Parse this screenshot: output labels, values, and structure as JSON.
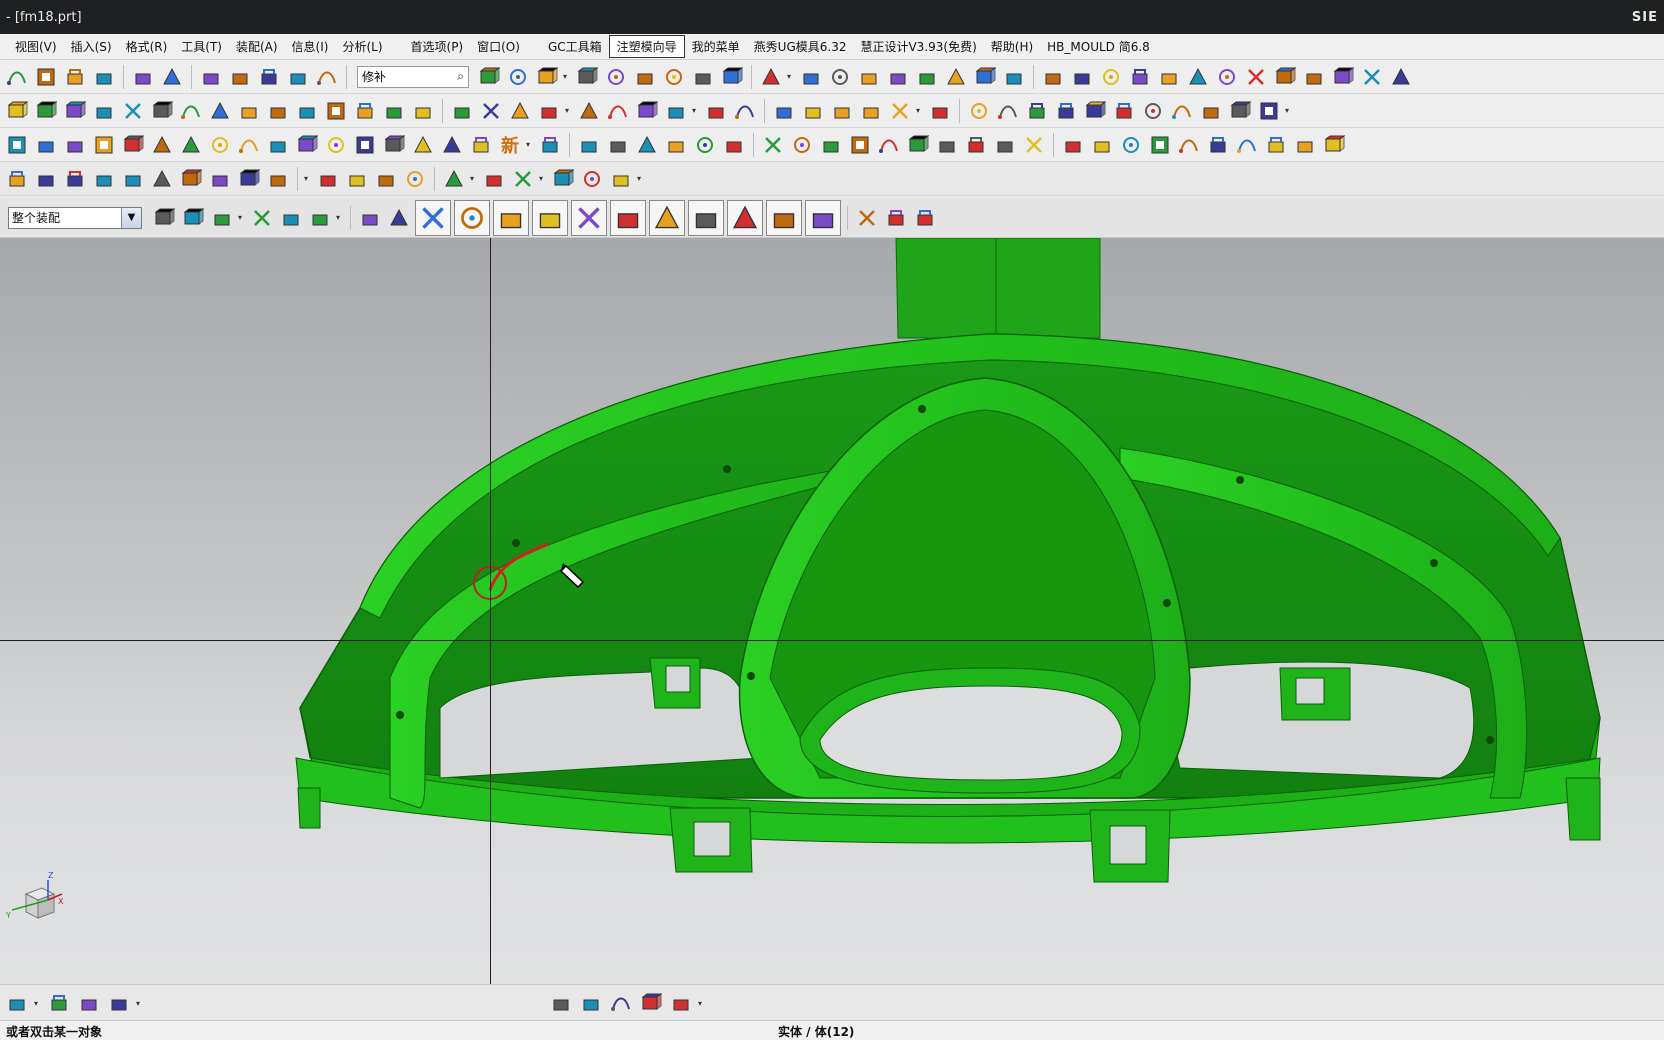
{
  "window": {
    "title": "- [fm18.prt]",
    "brand": "SIE"
  },
  "menu": {
    "items": [
      "视图(V)",
      "插入(S)",
      "格式(R)",
      "工具(T)",
      "装配(A)",
      "信息(I)",
      "分析(L)"
    ],
    "items2": [
      "首选项(P)",
      "窗口(O)"
    ],
    "items3": [
      "GC工具箱",
      "注塑模向导",
      "我的菜单",
      "燕秀UG模具6.32",
      "慧正设计V3.93(免费)",
      "帮助(H)",
      "HB_MOULD 简6.8"
    ]
  },
  "toolbar1": {
    "command_search_value": "修补"
  },
  "toolbar3": {
    "new_label": "新"
  },
  "selection": {
    "filter_value": "整个装配"
  },
  "status": {
    "prompt": "或者双击某一对象",
    "selection_info": "实体 / 体(12)"
  },
  "colors": {
    "model_green": "#22b81c",
    "model_dark": "#148a10",
    "highlight": "#d42020",
    "viewport_top": "#a6a8ab",
    "viewport_bottom": "#e1e2e3"
  },
  "icons": {
    "toolbar1": [
      "save-icon",
      "copy-icon",
      "paste-icon",
      "delete-icon",
      "undo-icon",
      "redo-icon",
      "edit-object-icon",
      "transform-icon",
      "properties-icon",
      "layer-icon",
      "info-icon",
      "fit-view-icon",
      "render-style-icon",
      "view-orient-icon",
      "shaded-icon",
      "shaded-edges-icon",
      "wireframe-icon",
      "hidden-dashed-icon",
      "static-wireframe-icon",
      "face-analysis-icon",
      "background-icon",
      "assembly-nav-icon",
      "component-icon",
      "text-icon",
      "dimension-icon",
      "box-icon",
      "block-icon",
      "color-table-icon",
      "clamp-icon",
      "mold-base-icon",
      "frame-icon",
      "slot-icon",
      "sweep-icon",
      "mirror-icon",
      "extrude-icon",
      "point-icon",
      "datum-csys-icon",
      "cross-icon",
      "export-icon",
      "white-swatch-icon",
      "camera-icon",
      "page-icon"
    ],
    "toolbar2": [
      "mold-wizard-icon",
      "part-icon",
      "layout-icon",
      "mold-csys-icon",
      "shrink-icon",
      "workpiece-icon",
      "cavity-layout-icon",
      "patch-icon",
      "parting-icon",
      "mold-base-icon",
      "standard-part-icon",
      "ejector-icon",
      "slider-icon",
      "insert-icon",
      "runner-icon",
      "gate-icon",
      "cooling-icon",
      "electrode-icon",
      "trim-icon",
      "pocket-icon",
      "bom-icon",
      "drawing-icon",
      "surface-icon",
      "split-icon",
      "view-manager-icon",
      "box-select-icon",
      "solid-yellow-icon",
      "cube-icon",
      "color-cube-icon",
      "rotate-icon",
      "line-icon",
      "rectangle-icon",
      "swept-surface-icon",
      "mesh-surface-icon",
      "offset-surface-icon",
      "face-blend-icon",
      "trim-sheet-icon",
      "sew-icon",
      "patch-surface-icon",
      "extend-icon",
      "book-icon",
      "bucket-icon"
    ],
    "toolbar3": [
      "datum-plane-icon",
      "circle-target-icon",
      "t-beam-icon",
      "wave-icon",
      "bracket-icon",
      "pocket-icon",
      "boss-icon",
      "slot-icon",
      "pad-icon",
      "rib-icon",
      "groove-icon",
      "hole-icon",
      "thread-icon",
      "flange-icon",
      "step-icon",
      "gear-icon",
      "house-icon",
      "new-icon",
      "spread-icon",
      "align-icon",
      "hook-icon",
      "angle-icon",
      "corner-icon",
      "square-icon",
      "tube-icon",
      "edge-blend-icon",
      "chamfer-icon",
      "draft-icon",
      "shell-icon",
      "hash-icon",
      "pin-icon",
      "sheet-icon",
      "stack-icon",
      "beam-icon",
      "switch-icon",
      "no-entry-icon",
      "cubes-icon",
      "spline-icon",
      "cube-outline-icon",
      "cube-orange-icon",
      "cube-solid-icon",
      "plane-icon",
      "figure-icon",
      "axes-icon",
      "panel-icon"
    ],
    "toolbar4": [
      "spiral-icon",
      "line-tool-icon",
      "arc-tool-icon",
      "circle-tool-icon",
      "fillet-tool-icon",
      "chamfer-tool-icon",
      "rectangle-tool-icon",
      "studio-spline-icon",
      "point-tool-icon",
      "polygon-icon",
      "quick-trim-icon",
      "quick-extend-icon",
      "make-corner-icon",
      "offset-curve-icon",
      "mirror-curve-icon",
      "pattern-curve-icon",
      "constraint-icon",
      "dimension-tool-icon",
      "gear-tool-icon",
      "measure-icon"
    ],
    "toolbar5": [
      "assembly-filter-icon",
      "filter-funnel-icon",
      "filter-select-icon",
      "point-select-icon",
      "chain-icon",
      "rect-select-icon",
      "snap-face-icon",
      "snap-body-icon"
    ],
    "snap_points": [
      "snap-all-icon",
      "snap-endpoint-icon",
      "snap-midpoint-icon",
      "snap-control-icon",
      "snap-intersection-icon",
      "snap-tangent-icon",
      "snap-arc-center-icon",
      "snap-quadrant-icon",
      "snap-existing-icon",
      "snap-on-curve-icon",
      "snap-on-surface-icon"
    ],
    "toolbar5_right": [
      "grid-icon",
      "color-swatch-icon",
      "box-outline-icon"
    ],
    "bottom_left": [
      "wcs-icon",
      "datum-axis-icon",
      "csys-icon",
      "orient-icon"
    ],
    "bottom_center": [
      "assembly-load-icon",
      "part-nav-icon",
      "tools-icon",
      "xf-icon",
      "table-icon"
    ]
  }
}
